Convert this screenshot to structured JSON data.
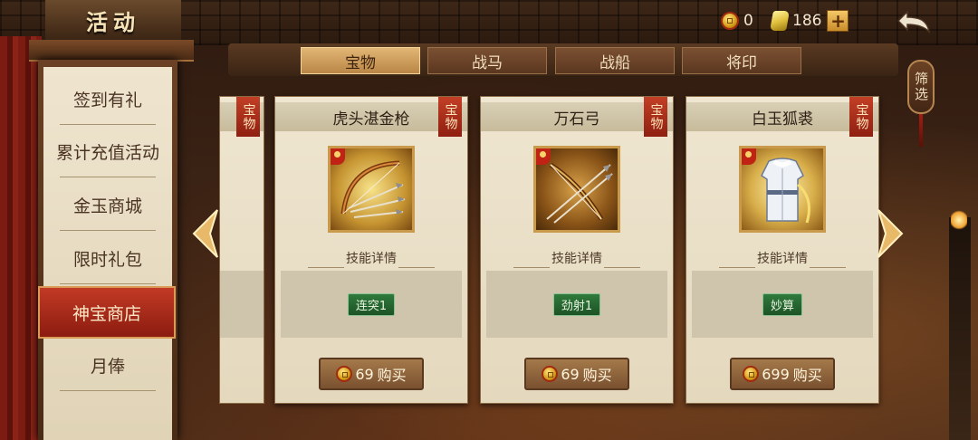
{
  "header": {
    "title": "活动",
    "currencies": [
      {
        "icon": "gold-coin-icon",
        "value": "0"
      },
      {
        "icon": "jade-ingot-icon",
        "value": "186"
      }
    ],
    "plus_label": "+",
    "back_icon": "back-arrow-icon"
  },
  "sidebar": {
    "items": [
      {
        "label": "签到有礼",
        "active": false
      },
      {
        "label": "累计充值活动",
        "active": false
      },
      {
        "label": "金玉商城",
        "active": false
      },
      {
        "label": "限时礼包",
        "active": false
      },
      {
        "label": "神宝商店",
        "active": true
      },
      {
        "label": "月俸",
        "active": false
      }
    ]
  },
  "tabs": [
    {
      "label": "宝物",
      "active": true
    },
    {
      "label": "战马",
      "active": false
    },
    {
      "label": "战船",
      "active": false
    },
    {
      "label": "将印",
      "active": false
    }
  ],
  "filter_label": "筛选",
  "partial_card_tag": "宝物",
  "cards": [
    {
      "name": "虎头湛金枪",
      "tag": "宝物",
      "item_icon": "bow-and-arrows-icon",
      "skill_heading": "技能详情",
      "skill": "连突1",
      "price": "69",
      "buy_label": "购买"
    },
    {
      "name": "万石弓",
      "tag": "宝物",
      "item_icon": "bow-and-arrows-icon",
      "skill_heading": "技能详情",
      "skill": "劲射1",
      "price": "69",
      "buy_label": "购买"
    },
    {
      "name": "白玉狐裘",
      "tag": "宝物",
      "item_icon": "white-robe-icon",
      "skill_heading": "技能详情",
      "skill": "妙算",
      "price": "699",
      "buy_label": "购买"
    }
  ],
  "colors": {
    "active_menu": "#b02d1c",
    "active_tab": "#d5a866",
    "skill_tag": "#2a6b35",
    "card_paper": "#ebe1ca"
  }
}
